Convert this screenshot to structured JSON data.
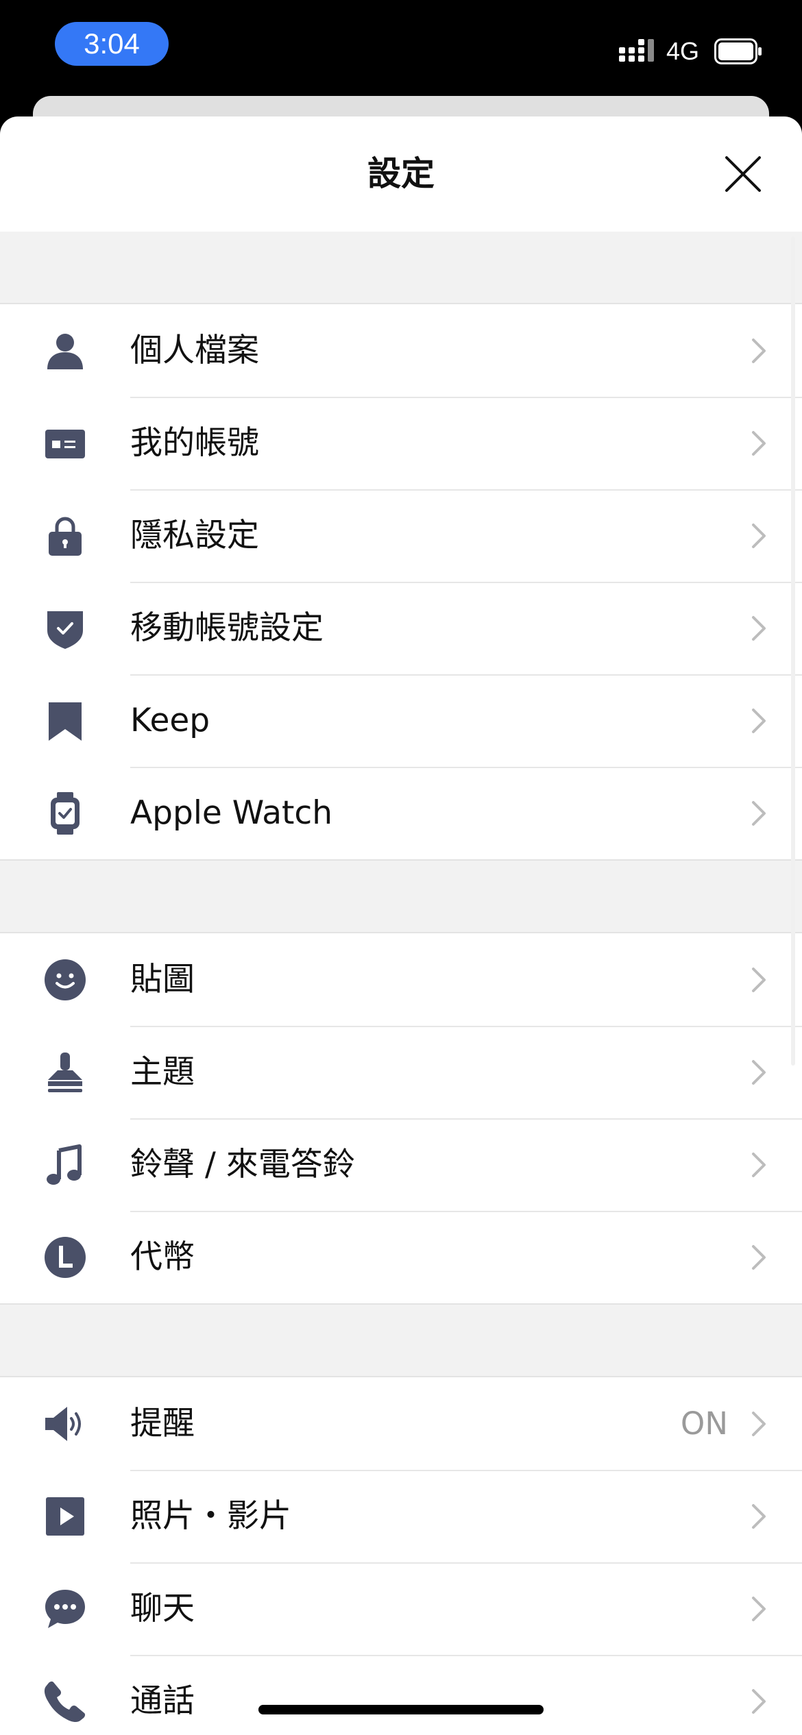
{
  "status_bar": {
    "time": "3:04",
    "network": "4G"
  },
  "sheet": {
    "title": "設定"
  },
  "sections": [
    {
      "items": [
        {
          "label": "個人檔案",
          "icon": "person-icon"
        },
        {
          "label": "我的帳號",
          "icon": "id-card-icon"
        },
        {
          "label": "隱私設定",
          "icon": "lock-icon"
        },
        {
          "label": "移動帳號設定",
          "icon": "shield-check-icon"
        },
        {
          "label": "Keep",
          "icon": "bookmark-icon"
        },
        {
          "label": "Apple Watch",
          "icon": "watch-icon"
        }
      ]
    },
    {
      "items": [
        {
          "label": "貼圖",
          "icon": "smiley-icon"
        },
        {
          "label": "主題",
          "icon": "stamp-icon"
        },
        {
          "label": "鈴聲 / 來電答鈴",
          "icon": "music-note-icon"
        },
        {
          "label": "代幣",
          "icon": "coin-icon"
        }
      ]
    },
    {
      "items": [
        {
          "label": "提醒",
          "icon": "speaker-icon",
          "value": "ON"
        },
        {
          "label": "照片・影片",
          "icon": "play-icon"
        },
        {
          "label": "聊天",
          "icon": "chat-bubble-icon"
        },
        {
          "label": "通話",
          "icon": "phone-icon"
        }
      ]
    }
  ],
  "colors": {
    "icon": "#4a5068",
    "accent": "#3478f6",
    "chevron": "#bdbdbd",
    "value_text": "#9a9a9a",
    "section_bg": "#f2f2f2"
  }
}
